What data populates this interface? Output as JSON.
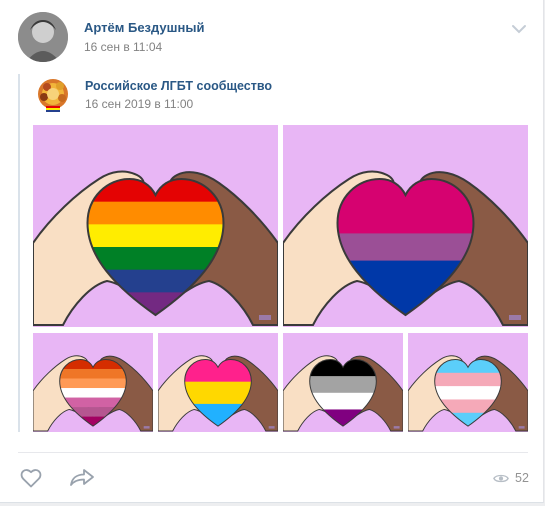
{
  "post": {
    "author": "Артём Бездушный",
    "date": "16 сен в 11:04",
    "repost": {
      "author": "Российское ЛГБТ сообщество",
      "date": "16 сен 2019 в 11:00"
    },
    "photos": [
      {
        "id": "photo-rainbow",
        "flag": [
          "#e40303",
          "#ff8c00",
          "#ffed00",
          "#008026",
          "#24408e",
          "#732982"
        ]
      },
      {
        "id": "photo-bisexual",
        "flag": [
          "#d60270",
          "#d60270",
          "#9b4f96",
          "#0038a8",
          "#0038a8"
        ]
      },
      {
        "id": "photo-lesbian",
        "flag": [
          "#d52d00",
          "#ef7627",
          "#ff9a56",
          "#ffffff",
          "#d162a4",
          "#b55690",
          "#a30262"
        ]
      },
      {
        "id": "photo-pansexual",
        "flag": [
          "#ff218c",
          "#ffd800",
          "#21b1ff"
        ]
      },
      {
        "id": "photo-asexual",
        "flag": [
          "#000000",
          "#a3a3a3",
          "#ffffff",
          "#800080"
        ]
      },
      {
        "id": "photo-transgender",
        "flag": [
          "#5bcefa",
          "#f5a9b8",
          "#ffffff",
          "#f5a9b8",
          "#5bcefa"
        ]
      }
    ],
    "stats": {
      "views": "52"
    }
  },
  "icons": {
    "like": "heart-icon",
    "share": "share-arrow-icon",
    "views": "eye-icon",
    "menu": "chevron-down-icon"
  }
}
